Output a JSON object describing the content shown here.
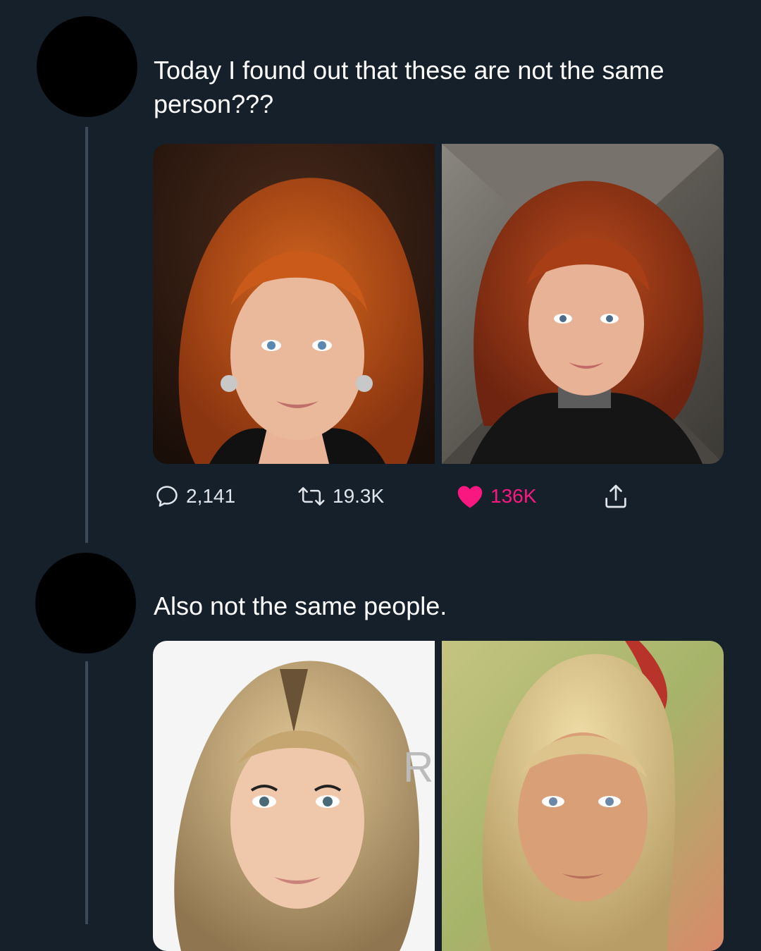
{
  "tweets": [
    {
      "text": "Today I found out that these are not the same person???",
      "stats": {
        "replies": "2,141",
        "retweets": "19.3K",
        "likes": "136K",
        "liked": true
      },
      "photos": [
        "redhead-woman-photo-left",
        "redhead-woman-photo-right"
      ]
    },
    {
      "text": "Also not the same people.",
      "photos": [
        "blonde-woman-photo-left",
        "blonde-woman-photo-right"
      ]
    }
  ],
  "colors": {
    "background": "#15202b",
    "text": "#ffffff",
    "action_icon": "#dfe5ea",
    "like": "#f91880",
    "thread_line": "#3a4a5a"
  },
  "icons": {
    "reply": "reply-icon",
    "retweet": "retweet-icon",
    "like": "heart-icon",
    "share": "share-icon"
  }
}
